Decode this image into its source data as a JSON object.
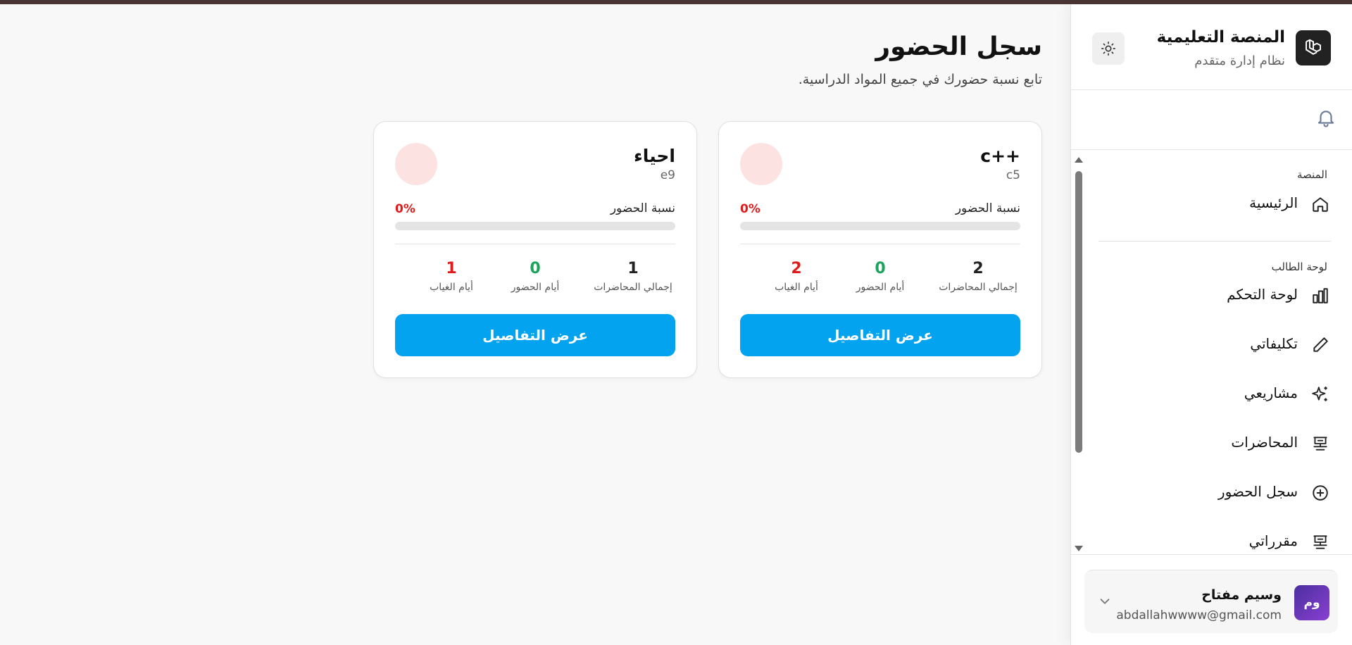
{
  "brand": {
    "title": "المنصة التعليمية",
    "subtitle": "نظام إدارة متقدم",
    "logo_icon": "laravel-logo-icon",
    "theme_icon": "sun-icon"
  },
  "notifications": {
    "icon": "bell-icon"
  },
  "sidebar": {
    "groups": [
      {
        "label": "المنصة"
      },
      {
        "label": "لوحة الطالب"
      }
    ],
    "items": [
      {
        "label": "الرئيسية",
        "icon": "home-icon"
      },
      {
        "label": "لوحة التحكم",
        "icon": "bar-chart-icon"
      },
      {
        "label": "تكليفاتي",
        "icon": "pencil-icon"
      },
      {
        "label": "مشاريعي",
        "icon": "sparkles-icon"
      },
      {
        "label": "المحاضرات",
        "icon": "presentation-icon"
      },
      {
        "label": "سجل الحضور",
        "icon": "plus-circle-icon"
      },
      {
        "label": "مقرراتي",
        "icon": "presentation-icon"
      }
    ]
  },
  "user": {
    "initials": "وم",
    "name": "وسيم مفتاح",
    "email": "abdallahwwww@gmail.com",
    "menu_icon": "chevron-down-icon"
  },
  "page": {
    "title": "سجل الحضور",
    "subtitle": "تابع نسبة حضورك في جميع المواد الدراسية."
  },
  "common": {
    "rate_label": "نسبة الحضور",
    "total_label": "إجمالي المحاضرات",
    "present_label": "أيام الحضور",
    "absent_label": "أيام الغياب",
    "details_button": "عرض التفاصيل"
  },
  "courses": [
    {
      "name": "c++",
      "code": "c5",
      "rate": "0%",
      "rate_fraction": 0,
      "total": "2",
      "present": "0",
      "absent": "2"
    },
    {
      "name": "احياء",
      "code": "e9",
      "rate": "0%",
      "rate_fraction": 0,
      "total": "1",
      "present": "0",
      "absent": "1"
    }
  ],
  "colors": {
    "accent": "#03a3f0",
    "absent": "#e01b1b",
    "present": "#1aa35a",
    "circle": "#fde2e2"
  }
}
